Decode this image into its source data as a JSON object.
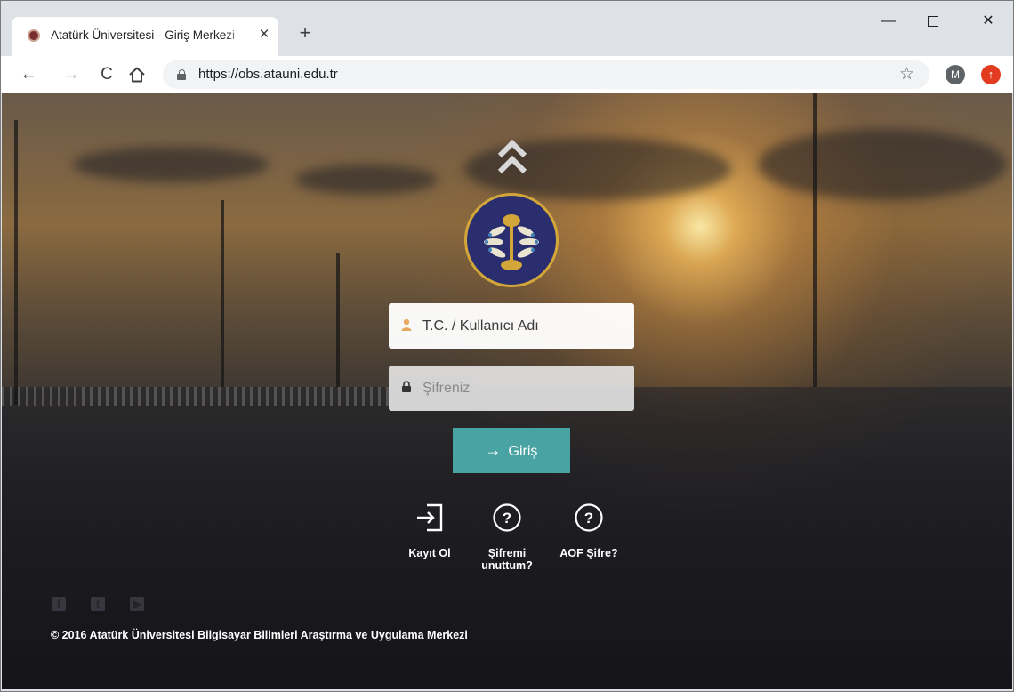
{
  "browser": {
    "tab_title": "Atatürk Üniversitesi - Giriş Merkezi",
    "tab_close": "✕",
    "new_tab": "+",
    "url": "https://obs.atauni.edu.tr",
    "profile_initial": "M",
    "window_controls": {
      "minimize": "—",
      "close": "✕"
    }
  },
  "login": {
    "username_placeholder": "T.C. / Kullanıcı Adı",
    "password_placeholder": "Şifreniz",
    "submit_label": "Giriş"
  },
  "actions": [
    {
      "label": "Kayıt Ol",
      "icon": "sign-in-icon"
    },
    {
      "label": "Şifremi unuttum?",
      "icon": "question-circle-icon"
    },
    {
      "label": "AOF Şifre?",
      "icon": "question-circle-icon"
    }
  ],
  "social": [
    "facebook-icon",
    "twitter-icon",
    "youtube-icon"
  ],
  "footer": "© 2016 Atatürk Üniversitesi Bilgisayar Bilimleri Araştırma ve Uygulama Merkezi",
  "colors": {
    "accent": "#4aa3a3",
    "user_icon": "#e8a860",
    "logo_gold": "#d3a63a",
    "logo_navy": "#2a2e6e"
  }
}
